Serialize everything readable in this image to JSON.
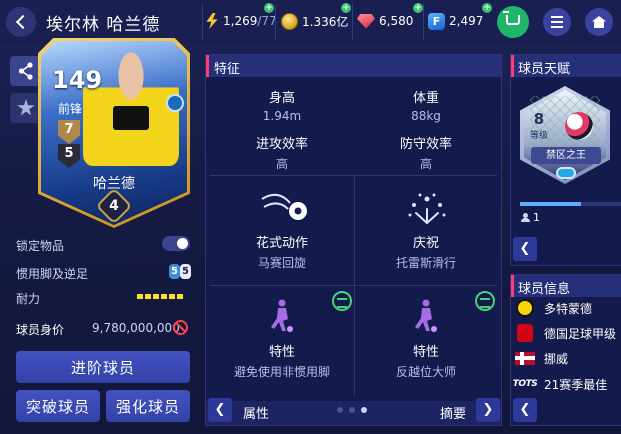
{
  "header": {
    "title": "埃尔林 哈兰德",
    "energy_current": "1,269",
    "energy_max": "/77",
    "coins": "1.336亿",
    "gems": "6,580",
    "fc_points": "2,497",
    "fc_icon_text": "F",
    "plus_symbol": "+"
  },
  "player_card": {
    "overall": "149",
    "position": "前锋",
    "rank_badge": "7",
    "skill_badge": "5",
    "name": "哈兰德",
    "level": "4"
  },
  "player_info": {
    "lock_label": "锁定物品",
    "foot_label": "惯用脚及逆足",
    "foot_left": "5",
    "foot_right": "5",
    "stamina_label": "耐力",
    "value_label": "球员身价",
    "value": "9,780,000,000"
  },
  "actions": {
    "advance": "进阶球员",
    "breakthrough": "突破球员",
    "enhance": "强化球员"
  },
  "traits_panel": {
    "title": "特征",
    "height_label": "身高",
    "height_value": "1.94m",
    "weight_label": "体重",
    "weight_value": "88kg",
    "attack_label": "进攻效率",
    "attack_value": "高",
    "defense_label": "防守效率",
    "defense_value": "高",
    "skill_move_label": "花式动作",
    "skill_move_value": "马赛回旋",
    "celebration_label": "庆祝",
    "celebration_value": "托雷斯滑行",
    "trait1_label": "特性",
    "trait1_value": "避免使用非惯用脚",
    "trait2_label": "特性",
    "trait2_value": "反越位大师",
    "footer_left": "属性",
    "footer_right": "摘要",
    "page_dots": 3,
    "active_dot": 3
  },
  "talent_panel": {
    "title": "球员天赋",
    "level": "8",
    "level_label": "等级",
    "talent_name": "禁区之王",
    "count": "1",
    "progress": 0.6
  },
  "info_panel": {
    "title": "球员信息",
    "items": [
      {
        "label": "多特蒙德",
        "icon": "bvb-crest-icon"
      },
      {
        "label": "德国足球甲级",
        "icon": "bundesliga-icon"
      },
      {
        "label": "挪威",
        "icon": "norway-flag-icon"
      },
      {
        "label": "21赛季最佳",
        "icon": "tots-icon",
        "icon_text": "TOTS"
      }
    ]
  },
  "colors": {
    "accent_green": "#1fb56b",
    "panel_header": "#262f7a",
    "tab_marker": "#ff3c73",
    "stamina": "#ffdd2a",
    "button": "#3a46b0"
  }
}
